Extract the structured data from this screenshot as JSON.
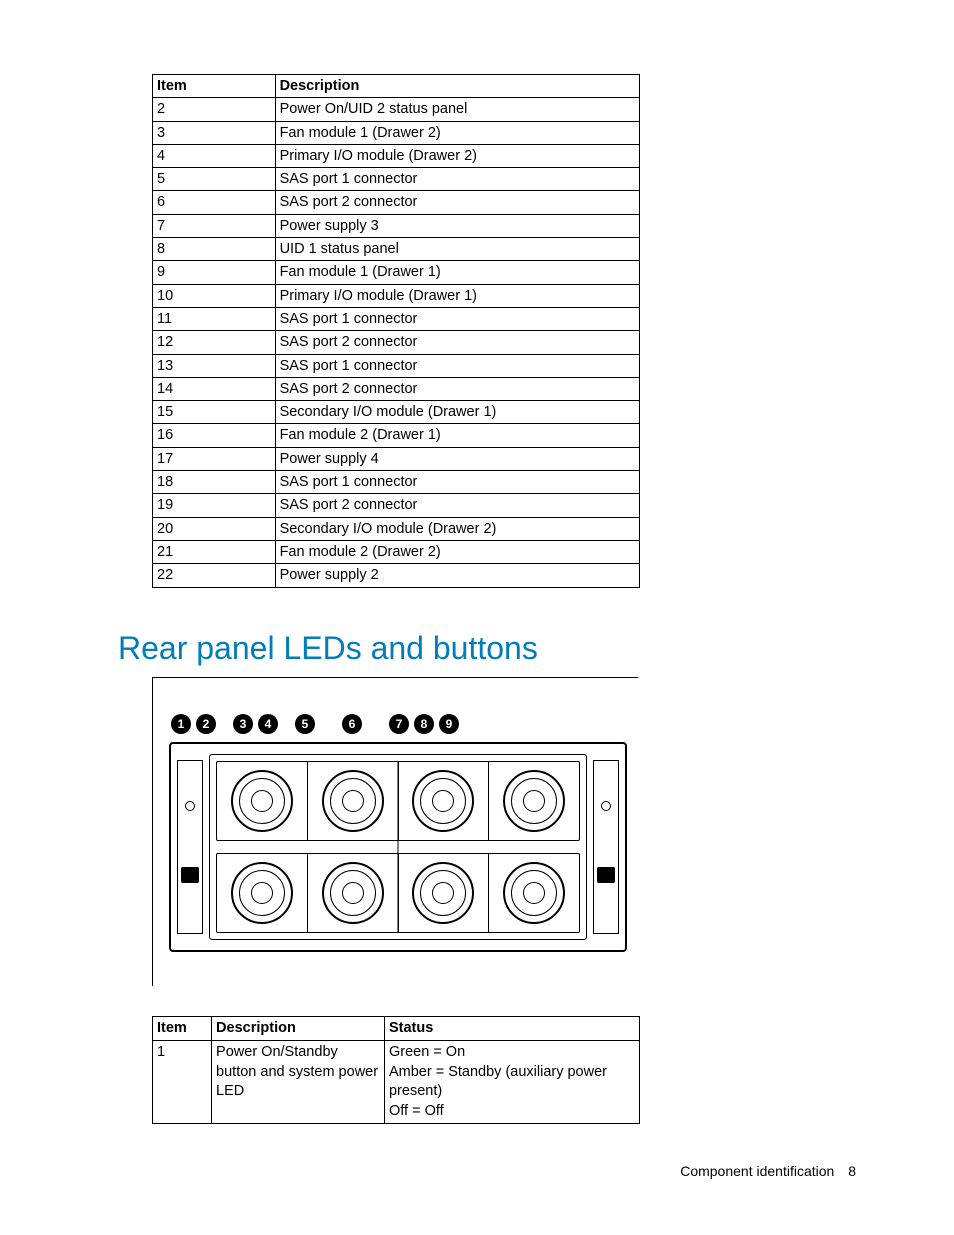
{
  "table1": {
    "headers": {
      "item": "Item",
      "desc": "Description"
    },
    "rows": [
      {
        "item": "2",
        "desc": "Power On/UID 2 status panel"
      },
      {
        "item": "3",
        "desc": "Fan module 1 (Drawer 2)"
      },
      {
        "item": "4",
        "desc": "Primary I/O module (Drawer 2)"
      },
      {
        "item": "5",
        "desc": "SAS port 1 connector"
      },
      {
        "item": "6",
        "desc": "SAS port 2 connector"
      },
      {
        "item": "7",
        "desc": "Power supply 3"
      },
      {
        "item": "8",
        "desc": "UID 1 status panel"
      },
      {
        "item": "9",
        "desc": "Fan module 1 (Drawer 1)"
      },
      {
        "item": "10",
        "desc": "Primary I/O module (Drawer 1)"
      },
      {
        "item": "11",
        "desc": "SAS port 1 connector"
      },
      {
        "item": "12",
        "desc": "SAS port 2 connector"
      },
      {
        "item": "13",
        "desc": "SAS port 1 connector"
      },
      {
        "item": "14",
        "desc": "SAS port 2 connector"
      },
      {
        "item": "15",
        "desc": "Secondary I/O module (Drawer 1)"
      },
      {
        "item": "16",
        "desc": "Fan module 2 (Drawer 1)"
      },
      {
        "item": "17",
        "desc": "Power supply 4"
      },
      {
        "item": "18",
        "desc": "SAS port 1 connector"
      },
      {
        "item": "19",
        "desc": "SAS port 2 connector"
      },
      {
        "item": "20",
        "desc": "Secondary I/O module (Drawer 2)"
      },
      {
        "item": "21",
        "desc": "Fan module 2 (Drawer 2)"
      },
      {
        "item": "22",
        "desc": "Power supply 2"
      }
    ]
  },
  "heading": "Rear panel LEDs and buttons",
  "callouts": [
    "1",
    "2",
    "3",
    "4",
    "5",
    "6",
    "7",
    "8",
    "9"
  ],
  "table2": {
    "headers": {
      "item": "Item",
      "desc": "Description",
      "status": "Status"
    },
    "rows": [
      {
        "item": "1",
        "desc": "Power On/Standby button and system power LED",
        "status": "Green = On\nAmber = Standby (auxiliary power present)\nOff = Off"
      }
    ]
  },
  "footer": {
    "section": "Component identification",
    "page": "8"
  }
}
